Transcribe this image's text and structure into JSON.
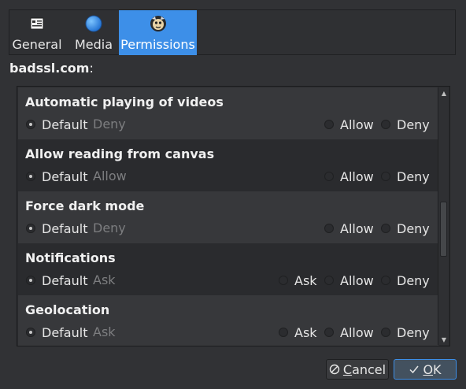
{
  "tabs": [
    {
      "label": "General",
      "icon": "general-page-icon"
    },
    {
      "label": "Media",
      "icon": "media-globe-icon"
    },
    {
      "label": "Permissions",
      "icon": "permissions-mascot-icon",
      "active": true
    }
  ],
  "site": {
    "domain": "badssl.com",
    "suffix": ":"
  },
  "permissions": [
    {
      "title": "Automatic playing of videos",
      "default_label": "Default",
      "default_value": "Deny",
      "options": [
        "Allow",
        "Deny"
      ]
    },
    {
      "title": "Allow reading from canvas",
      "default_label": "Default",
      "default_value": "Allow",
      "options": [
        "Allow",
        "Deny"
      ]
    },
    {
      "title": "Force dark mode",
      "default_label": "Default",
      "default_value": "Deny",
      "options": [
        "Allow",
        "Deny"
      ]
    },
    {
      "title": "Notifications",
      "default_label": "Default",
      "default_value": "Ask",
      "options": [
        "Ask",
        "Allow",
        "Deny"
      ]
    },
    {
      "title": "Geolocation",
      "default_label": "Default",
      "default_value": "Ask",
      "options": [
        "Ask",
        "Allow",
        "Deny"
      ]
    }
  ],
  "buttons": {
    "cancel": {
      "first": "C",
      "rest": "ancel",
      "icon": "cancel-circle-icon"
    },
    "ok": {
      "first": "O",
      "rest": "K",
      "icon": "checkmark-icon"
    }
  },
  "colors": {
    "accent": "#3d8fe8",
    "background": "#313235",
    "muted_text": "#7d7e80"
  }
}
